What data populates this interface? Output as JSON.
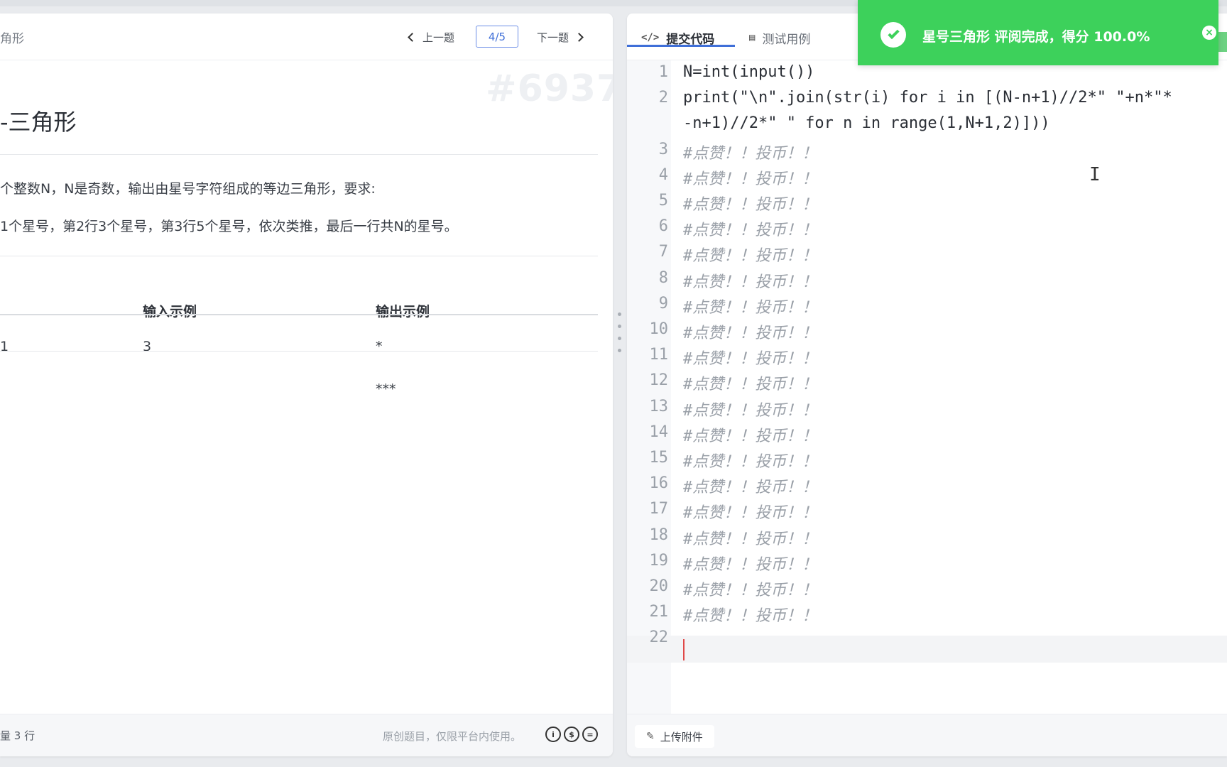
{
  "problem": {
    "title_small": "角形",
    "nav": {
      "prev_label": "上一题",
      "next_label": "下一题",
      "page": "4/5"
    },
    "watermark_id": "#6937",
    "title": "-三角形",
    "desc_line1": "个整数N，N是奇数，输出由星号字符组成的等边三角形，要求:",
    "desc_line2": "1个星号，第2行3个星号，第3行5个星号，依次类推，最后一行共N的星号。",
    "example": {
      "input_header": "输入示例",
      "output_header": "输出示例",
      "row_index": "1",
      "input_value": "3",
      "output_line1": "*",
      "output_line2": "***"
    },
    "footer_left": "量 3 行",
    "footer_right": "原创题目，仅限平台内使用。",
    "license_icons": [
      "cc-by-icon",
      "cc-nc-icon",
      "cc-nd-icon"
    ]
  },
  "editor": {
    "tabs": [
      {
        "label": "提交代码",
        "icon": "code-icon"
      },
      {
        "label": "测试用例",
        "icon": "test-case-icon"
      }
    ],
    "line_numbers": [
      "1",
      "2",
      "",
      "3",
      "4",
      "5",
      "6",
      "7",
      "8",
      "9",
      "10",
      "11",
      "12",
      "13",
      "14",
      "15",
      "16",
      "17",
      "18",
      "19",
      "20",
      "21",
      "22"
    ],
    "code_lines": [
      "N=int(input())",
      "print(\"\\n\".join(str(i) for i in [(N-n+1)//2*\" \"+n*\"*",
      "-n+1)//2*\" \" for n in range(1,N+1,2)]))",
      "#点赞！！投币！！",
      "#点赞！！投币！！",
      "#点赞！！投币！！",
      "#点赞！！投币！！",
      "#点赞！！投币！！",
      "#点赞！！投币！！",
      "#点赞！！投币！！",
      "#点赞！！投币！！",
      "#点赞！！投币！！",
      "#点赞！！投币！！",
      "#点赞！！投币！！",
      "#点赞！！投币！！",
      "#点赞！！投币！！",
      "#点赞！！投币！！",
      "#点赞！！投币！！",
      "#点赞！！投币！！",
      "#点赞！！投币！！",
      "#点赞！！投币！！",
      "#点赞！！投币！！",
      ""
    ],
    "upload_label": "上传附件"
  },
  "toast": {
    "message": "星号三角形 评阅完成，得分 100.0%",
    "close_symbol": "×",
    "color": "#3dd15b"
  },
  "colors": {
    "accent": "#3f6fd8",
    "success": "#3dd15b",
    "caret": "#e04848"
  }
}
